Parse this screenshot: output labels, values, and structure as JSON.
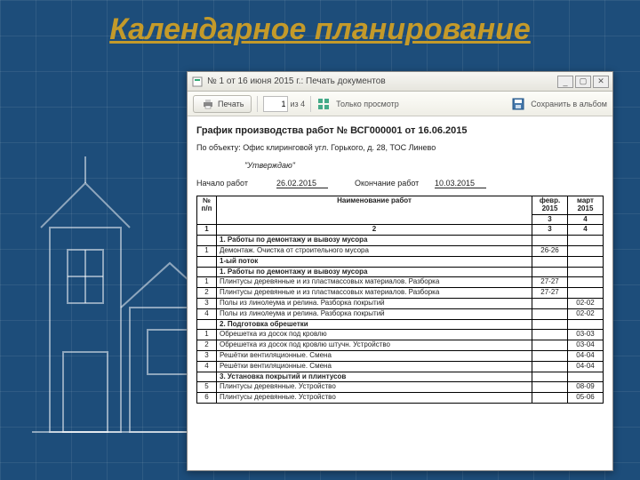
{
  "slide_title": "Календарное планирование",
  "window": {
    "title": "№ 1 от 16 июня 2015 г.: Печать документов"
  },
  "toolbar": {
    "print_label": "Печать",
    "page_value": "1",
    "page_total": "из 4",
    "readonly_label": "Только просмотр",
    "save_label": "Сохранить в альбом"
  },
  "doc": {
    "title": "График производства работ № ВСГ000001 от 16.06.2015",
    "object_label": "По объекту:",
    "object_text": "Офис клиринговой угл. Горького, д. 28, ТОС Линево",
    "approve": "\"Утверждаю\"",
    "start_label": "Начало работ",
    "start_value": "26.02.2015",
    "end_label": "Окончание работ",
    "end_value": "10.03.2015"
  },
  "table": {
    "head": {
      "num": "№ п/п",
      "name": "Наименование работ",
      "month1_top": "февр.",
      "month1_bot": "2015",
      "month2_top": "март",
      "month2_bot": "2015",
      "sub1": "1",
      "sub2": "2",
      "sub3": "3",
      "sub4": "4"
    },
    "rows": [
      {
        "num": "",
        "name": "1. Работы по демонтажу и вывозу мусора",
        "m1": "",
        "m2": "",
        "section": true
      },
      {
        "num": "1",
        "name": "Демонтаж. Очистка от строительного мусора",
        "m1": "26-26",
        "m2": ""
      },
      {
        "num": "",
        "name": "1-ый поток",
        "m1": "",
        "m2": "",
        "section": true
      },
      {
        "num": "",
        "name": "1. Работы по демонтажу и вывозу мусора",
        "m1": "",
        "m2": "",
        "section": true
      },
      {
        "num": "1",
        "name": "Плинтусы деревянные и из пластмассовых материалов. Разборка",
        "m1": "27-27",
        "m2": ""
      },
      {
        "num": "2",
        "name": "Плинтусы деревянные и из пластмассовых материалов. Разборка",
        "m1": "27-27",
        "m2": ""
      },
      {
        "num": "3",
        "name": "Полы из линолеума и релина. Разборка покрытий",
        "m1": "",
        "m2": "02-02"
      },
      {
        "num": "4",
        "name": "Полы из линолеума и релина. Разборка покрытий",
        "m1": "",
        "m2": "02-02"
      },
      {
        "num": "",
        "name": "2. Подготовка обрешетки",
        "m1": "",
        "m2": "",
        "section": true
      },
      {
        "num": "1",
        "name": "Обрешетка из досок под кровлю",
        "m1": "",
        "m2": "03-03"
      },
      {
        "num": "2",
        "name": "Обрешетка из досок под кровлю штучн. Устройство",
        "m1": "",
        "m2": "03-04"
      },
      {
        "num": "3",
        "name": "Решётки вентиляционные. Смена",
        "m1": "",
        "m2": "04-04"
      },
      {
        "num": "4",
        "name": "Решётки вентиляционные. Смена",
        "m1": "",
        "m2": "04-04"
      },
      {
        "num": "",
        "name": "3. Установка покрытий и плинтусов",
        "m1": "",
        "m2": "",
        "section": true
      },
      {
        "num": "5",
        "name": "Плинтусы деревянные. Устройство",
        "m1": "",
        "m2": "08-09"
      },
      {
        "num": "6",
        "name": "Плинтусы деревянные. Устройство",
        "m1": "",
        "m2": "05-06"
      }
    ]
  }
}
